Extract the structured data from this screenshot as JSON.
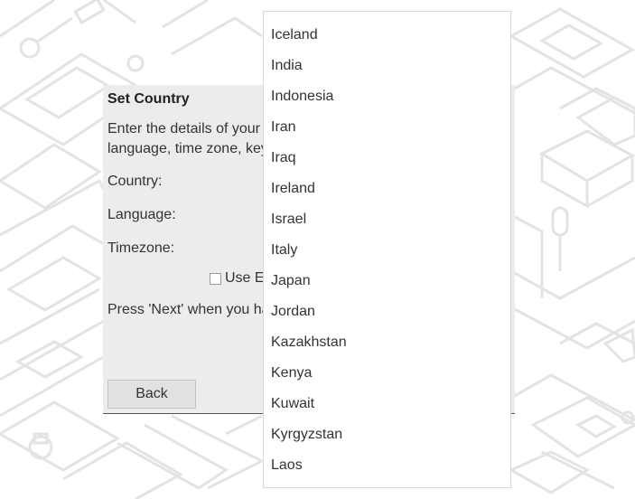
{
  "dialog": {
    "title": "Set Country",
    "desc_line1": "Enter the details of your l",
    "desc_line2": "language, time zone, key",
    "country_label": "Country:",
    "language_label": "Language:",
    "timezone_label": "Timezone:",
    "checkbox_label": "Use E",
    "press_next": "Press 'Next' when you ha",
    "back_label": "Back"
  },
  "dropdown": {
    "items": [
      "Iceland",
      "India",
      "Indonesia",
      "Iran",
      "Iraq",
      "Ireland",
      "Israel",
      "Italy",
      "Japan",
      "Jordan",
      "Kazakhstan",
      "Kenya",
      "Kuwait",
      "Kyrgyzstan",
      "Laos"
    ]
  }
}
